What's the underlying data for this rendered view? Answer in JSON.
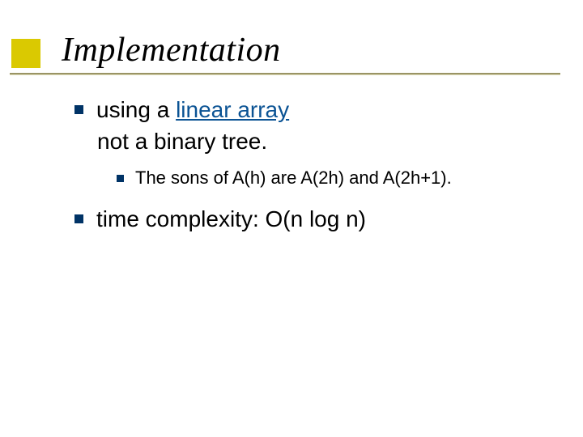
{
  "title": "Implementation",
  "bullets": {
    "b1_line1_pre": "using a ",
    "b1_line1_link": "linear array",
    "b1_line2": "not a binary tree.",
    "b1_sub1": "The sons of A(h) are A(2h) and A(2h+1).",
    "b2": "time complexity: O(n log n)"
  }
}
